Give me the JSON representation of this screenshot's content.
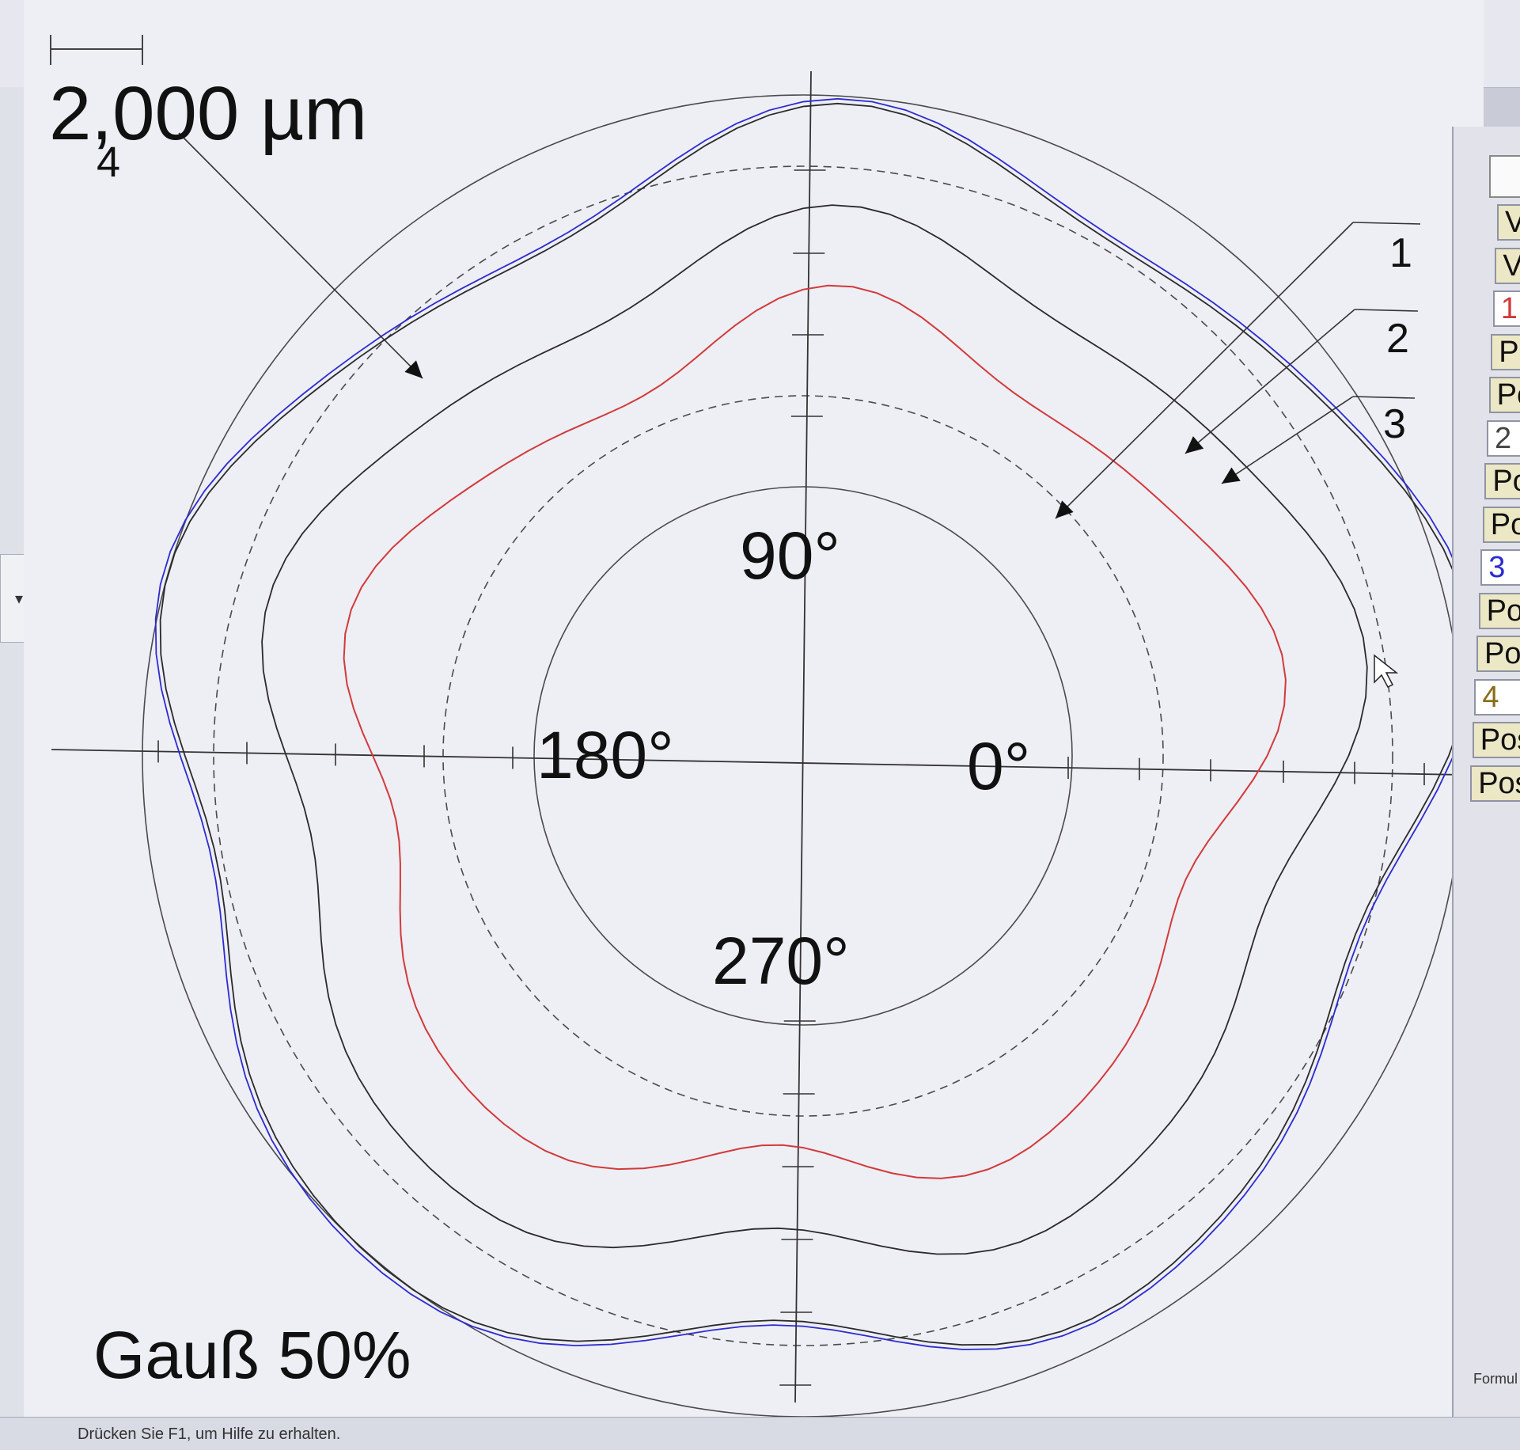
{
  "toolbar": {
    "buttons": [
      {
        "name": "edit-chart-icon"
      },
      {
        "name": "print-preview-icon"
      },
      {
        "name": "printer-icon"
      },
      {
        "name": "users-icon"
      },
      {
        "name": "exit-door-icon"
      }
    ]
  },
  "plot": {
    "scale_label": "2,000 µm",
    "scale_sub": "4",
    "filter_label": "Gauß 50%",
    "angle_labels": {
      "deg0": "0°",
      "deg90": "90°",
      "deg180": "180°",
      "deg270": "270°"
    },
    "curve_numbers": [
      "1",
      "2",
      "3"
    ],
    "colors": {
      "curve_red": "#d23a3a",
      "curve_blue": "#2b2bd0",
      "curve_dark": "#2a2a2a",
      "rings": "#4a4a4a"
    }
  },
  "side_panel": {
    "items": [
      "V",
      "V",
      "1",
      "Pc",
      "Pc",
      "2",
      "Po",
      "Po",
      "3",
      "Pos",
      "Pos",
      "4",
      "Pos",
      "Pos"
    ],
    "formula_label": "Formul"
  },
  "status_bar": {
    "text": "Drücken Sie F1, um Hilfe zu erhalten."
  }
}
